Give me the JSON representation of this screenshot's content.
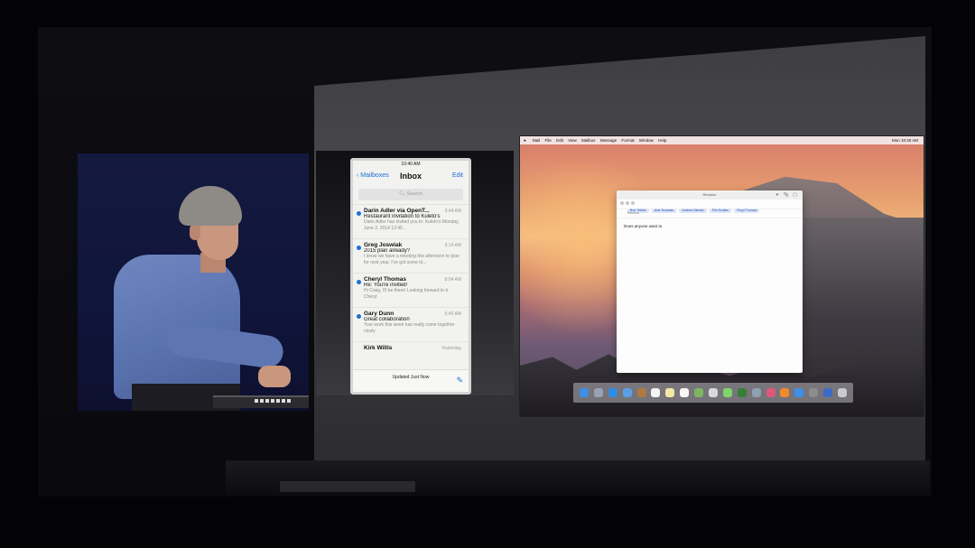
{
  "iphone": {
    "status_time": "10:40 AM",
    "back_label": "Mailboxes",
    "title": "Inbox",
    "edit_label": "Edit",
    "search_placeholder": "Search",
    "messages": [
      {
        "sender": "Darin Adler via OpenT...",
        "time": "9:44 AM",
        "subject": "Restaurant Invitation to Kuleto's",
        "preview": "Darin Adler has invited you to: Kuleto's Monday, June 2, 2014 12:45..."
      },
      {
        "sender": "Greg Joswiak",
        "time": "9:14 AM",
        "subject": "2015 plan already?",
        "preview": "I know we have a meeting this afternoon to plan for next year, I've got some id..."
      },
      {
        "sender": "Cheryl Thomas",
        "time": "8:04 AM",
        "subject": "Re: You're invited!",
        "preview": "Hi Craig, I'll be there! Looking forward to it. Cheryl"
      },
      {
        "sender": "Gary Dunn",
        "time": "5:40 AM",
        "subject": "Great collaboration",
        "preview": "Your work this week has really come together nicely"
      },
      {
        "sender": "Kirk Willis",
        "time": "Yesterday",
        "subject": "",
        "preview": ""
      }
    ],
    "updated_text": "Updated Just Now",
    "compose_icon": "compose-icon"
  },
  "mac": {
    "menubar": {
      "apple": "",
      "items": [
        "Mail",
        "File",
        "Edit",
        "View",
        "Mailbox",
        "Message",
        "Format",
        "Window",
        "Help"
      ],
      "clock": "Mon 10:40 AM"
    },
    "mail_window": {
      "title": "Reunion",
      "recipients": [
        "Bud Tribble",
        "Avie Tevanian",
        "Andrew Stemitz",
        "Phil Schiller",
        "Floyd Thomas"
      ],
      "subject": "Reunion",
      "body": "Does anyone want to"
    },
    "dock_apps": [
      {
        "name": "finder-icon",
        "color": "#3d8fe8"
      },
      {
        "name": "launchpad-icon",
        "color": "#9aa3b5"
      },
      {
        "name": "safari-icon",
        "color": "#2f8de4"
      },
      {
        "name": "mail-icon",
        "color": "#5a9fe6"
      },
      {
        "name": "contacts-icon",
        "color": "#b07a3e"
      },
      {
        "name": "calendar-icon",
        "color": "#f4f4f4"
      },
      {
        "name": "notes-icon",
        "color": "#f2e9a6"
      },
      {
        "name": "reminders-icon",
        "color": "#f6f6f6"
      },
      {
        "name": "maps-icon",
        "color": "#7fb463"
      },
      {
        "name": "photos-icon",
        "color": "#d9d9d9"
      },
      {
        "name": "messages-icon",
        "color": "#7fd46a"
      },
      {
        "name": "facetime-icon",
        "color": "#3a7d36"
      },
      {
        "name": "preview-icon",
        "color": "#8fa0b3"
      },
      {
        "name": "itunes-icon",
        "color": "#e0577d"
      },
      {
        "name": "ibooks-icon",
        "color": "#f08a2a"
      },
      {
        "name": "app-store-icon",
        "color": "#3d8fe8"
      },
      {
        "name": "system-preferences-icon",
        "color": "#8d8d8d"
      },
      {
        "name": "documents-icon",
        "color": "#3a6cc7"
      },
      {
        "name": "trash-icon",
        "color": "#c9c9cf"
      }
    ]
  }
}
